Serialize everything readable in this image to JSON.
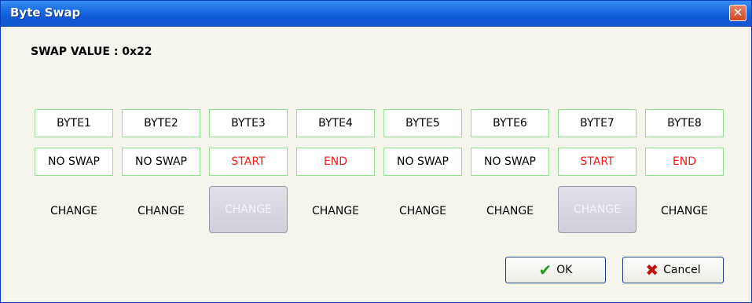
{
  "window": {
    "title": "Byte Swap",
    "close_icon": "close-icon"
  },
  "swap": {
    "label": "SWAP VALUE :",
    "value": "0x22"
  },
  "bytes": [
    "BYTE1",
    "BYTE2",
    "BYTE3",
    "BYTE4",
    "BYTE5",
    "BYTE6",
    "BYTE7",
    "BYTE8"
  ],
  "states": [
    "NO SWAP",
    "NO SWAP",
    "START",
    "END",
    "NO SWAP",
    "NO SWAP",
    "START",
    "END"
  ],
  "change_label": "CHANGE",
  "buttons": {
    "ok": "OK",
    "cancel": "Cancel"
  },
  "colors": {
    "title_bar": "#1e6fe6",
    "state_highlight": "#ff1a1a",
    "cell_border": "#8fe38f"
  }
}
